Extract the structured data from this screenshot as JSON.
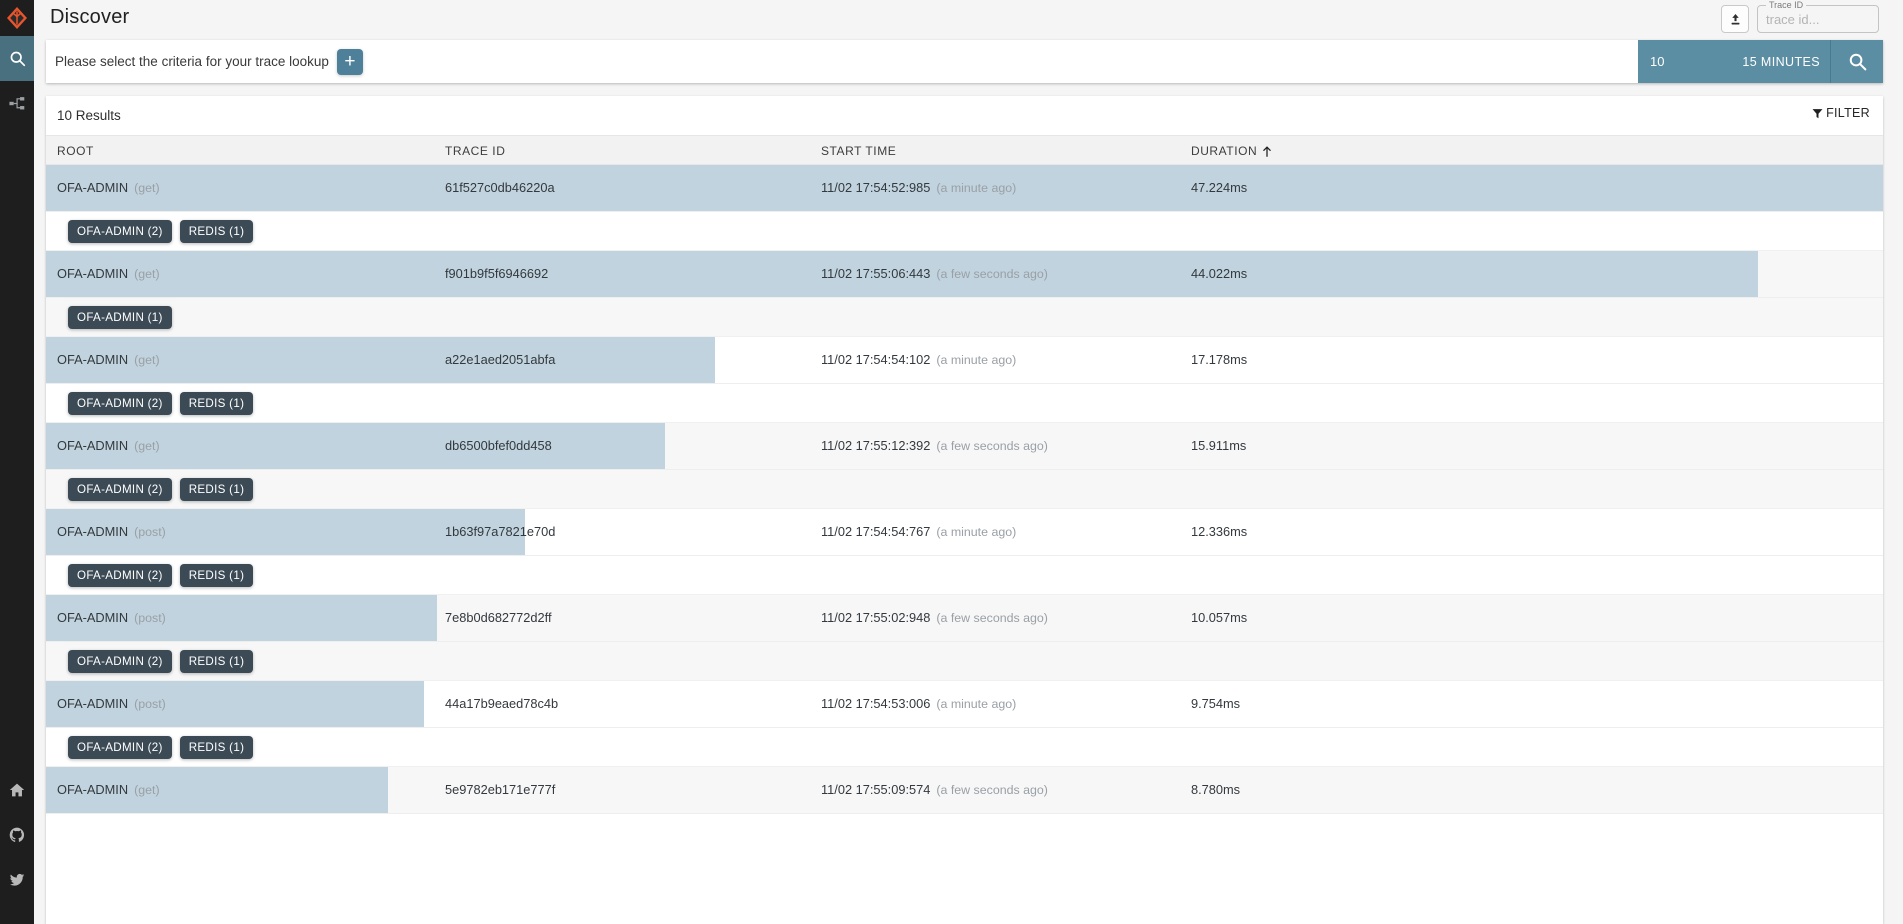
{
  "sidebar": {
    "logo_name": "zipkin-logo",
    "items": [
      {
        "name": "search-icon",
        "label": "Discover",
        "active": true
      },
      {
        "name": "dependencies-icon",
        "label": "Dependencies",
        "active": false
      }
    ],
    "social": [
      {
        "name": "home-icon",
        "label": "Home"
      },
      {
        "name": "github-icon",
        "label": "GitHub"
      },
      {
        "name": "twitter-icon",
        "label": "Twitter"
      }
    ]
  },
  "header": {
    "title": "Discover",
    "upload_icon": "upload-icon",
    "trace_id": {
      "legend": "Trace ID",
      "placeholder": "trace id...",
      "value": ""
    }
  },
  "searchbar": {
    "criteria_placeholder": "Please select the criteria for your trace lookup",
    "add_label": "+",
    "limit": "10",
    "lookback": "15 MINUTES",
    "search_icon": "search-icon",
    "accent_color": "#5b8da3",
    "add_button_color": "#4e8099"
  },
  "results": {
    "count_label": "10 Results",
    "filter_label": "FILTER",
    "filter_icon": "funnel-icon",
    "columns": [
      {
        "key": "root",
        "label": "ROOT"
      },
      {
        "key": "trace_id",
        "label": "TRACE ID"
      },
      {
        "key": "start_time",
        "label": "START TIME"
      },
      {
        "key": "duration",
        "label": "DURATION",
        "sort": "asc",
        "sort_icon": "arrow-up-icon"
      }
    ],
    "bar_color": "#c1d3de",
    "chip_color": "#3b4a55",
    "rows": [
      {
        "root_service": "OFA-ADMIN",
        "root_span": "(get)",
        "trace_id": "61f527c0db46220a",
        "start_time": "11/02 17:54:52:985",
        "relative": "(a minute ago)",
        "duration": "47.224ms",
        "bar_pct": 100,
        "chips": [
          "OFA-ADMIN (2)",
          "REDIS (1)"
        ]
      },
      {
        "root_service": "OFA-ADMIN",
        "root_span": "(get)",
        "trace_id": "f901b9f5f6946692",
        "start_time": "11/02 17:55:06:443",
        "relative": "(a few seconds ago)",
        "duration": "44.022ms",
        "bar_pct": 93.2,
        "chips": [
          "OFA-ADMIN (1)"
        ]
      },
      {
        "root_service": "OFA-ADMIN",
        "root_span": "(get)",
        "trace_id": "a22e1aed2051abfa",
        "start_time": "11/02 17:54:54:102",
        "relative": "(a minute ago)",
        "duration": "17.178ms",
        "bar_pct": 36.4,
        "chips": [
          "OFA-ADMIN (2)",
          "REDIS (1)"
        ]
      },
      {
        "root_service": "OFA-ADMIN",
        "root_span": "(get)",
        "trace_id": "db6500bfef0dd458",
        "start_time": "11/02 17:55:12:392",
        "relative": "(a few seconds ago)",
        "duration": "15.911ms",
        "bar_pct": 33.7,
        "chips": [
          "OFA-ADMIN (2)",
          "REDIS (1)"
        ]
      },
      {
        "root_service": "OFA-ADMIN",
        "root_span": "(post)",
        "trace_id": "1b63f97a7821e70d",
        "start_time": "11/02 17:54:54:767",
        "relative": "(a minute ago)",
        "duration": "12.336ms",
        "bar_pct": 26.1,
        "chips": [
          "OFA-ADMIN (2)",
          "REDIS (1)"
        ]
      },
      {
        "root_service": "OFA-ADMIN",
        "root_span": "(post)",
        "trace_id": "7e8b0d682772d2ff",
        "start_time": "11/02 17:55:02:948",
        "relative": "(a few seconds ago)",
        "duration": "10.057ms",
        "bar_pct": 21.3,
        "chips": [
          "OFA-ADMIN (2)",
          "REDIS (1)"
        ]
      },
      {
        "root_service": "OFA-ADMIN",
        "root_span": "(post)",
        "trace_id": "44a17b9eaed78c4b",
        "start_time": "11/02 17:54:53:006",
        "relative": "(a minute ago)",
        "duration": "9.754ms",
        "bar_pct": 20.6,
        "chips": [
          "OFA-ADMIN (2)",
          "REDIS (1)"
        ]
      },
      {
        "root_service": "OFA-ADMIN",
        "root_span": "(get)",
        "trace_id": "5e9782eb171e777f",
        "start_time": "11/02 17:55:09:574",
        "relative": "(a few seconds ago)",
        "duration": "8.780ms",
        "bar_pct": 18.6,
        "chips": []
      }
    ]
  }
}
